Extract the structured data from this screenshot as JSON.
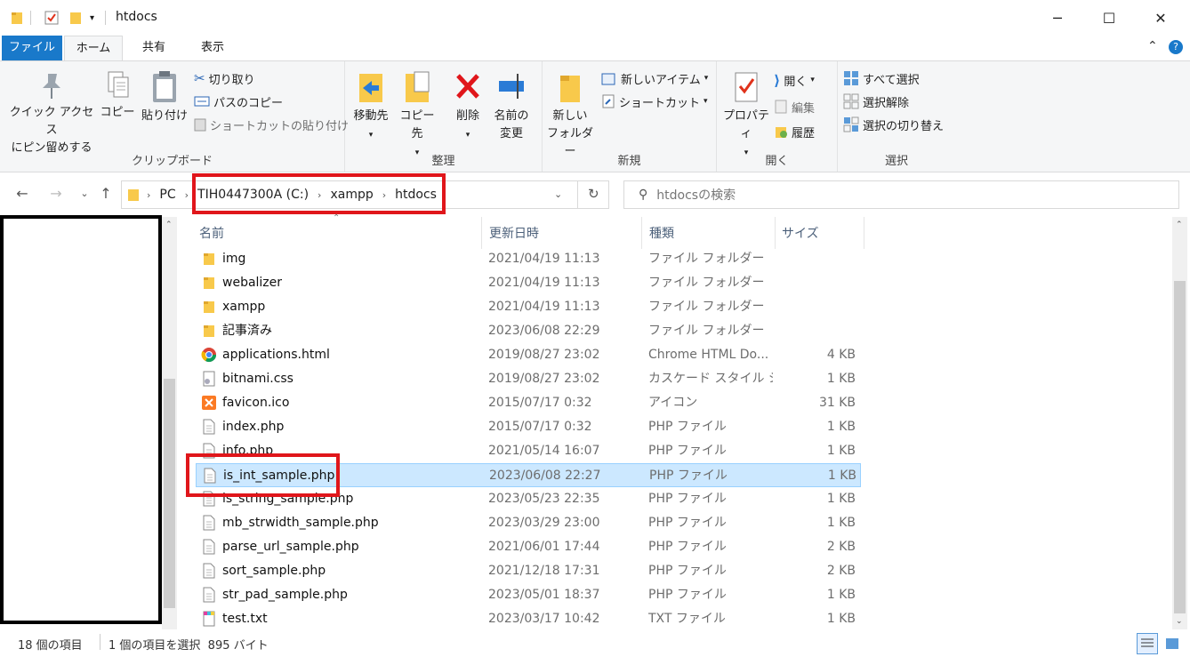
{
  "window": {
    "title": "htdocs",
    "minimize": "─",
    "maximize": "☐",
    "close": "✕"
  },
  "tabs": {
    "file": "ファイル",
    "home": "ホーム",
    "share": "共有",
    "view": "表示"
  },
  "ribbon": {
    "clipboard": {
      "label": "クリップボード",
      "pin_line1": "クイック アクセス",
      "pin_line2": "にピン留めする",
      "copy": "コピー",
      "paste": "貼り付け",
      "cut": "切り取り",
      "copy_path": "パスのコピー",
      "paste_shortcut": "ショートカットの貼り付け"
    },
    "organize": {
      "label": "整理",
      "move_to": "移動先",
      "copy_to": "コピー先",
      "delete": "削除",
      "rename_line1": "名前の",
      "rename_line2": "変更"
    },
    "new": {
      "label": "新規",
      "new_folder_line1": "新しい",
      "new_folder_line2": "フォルダー",
      "new_item": "新しいアイテム",
      "shortcut": "ショートカット"
    },
    "open": {
      "label": "開く",
      "properties": "プロパティ",
      "open": "開く",
      "edit": "編集",
      "history": "履歴"
    },
    "select": {
      "label": "選択",
      "select_all": "すべて選択",
      "select_none": "選択解除",
      "invert": "選択の切り替え"
    }
  },
  "address": {
    "crumbs": [
      "PC",
      "TIH0447300A (C:)",
      "xampp",
      "htdocs"
    ],
    "search_placeholder": "htdocsの検索"
  },
  "columns": {
    "name": "名前",
    "date": "更新日時",
    "type": "種類",
    "size": "サイズ"
  },
  "files": [
    {
      "name": "img",
      "date": "2021/04/19 11:13",
      "type": "ファイル フォルダー",
      "size": "",
      "icon": "folder-icon"
    },
    {
      "name": "webalizer",
      "date": "2021/04/19 11:13",
      "type": "ファイル フォルダー",
      "size": "",
      "icon": "folder-icon"
    },
    {
      "name": "xampp",
      "date": "2021/04/19 11:13",
      "type": "ファイル フォルダー",
      "size": "",
      "icon": "folder-icon"
    },
    {
      "name": "記事済み",
      "date": "2023/06/08 22:29",
      "type": "ファイル フォルダー",
      "size": "",
      "icon": "folder-icon"
    },
    {
      "name": "applications.html",
      "date": "2019/08/27 23:02",
      "type": "Chrome HTML Do...",
      "size": "4 KB",
      "icon": "chrome-icon"
    },
    {
      "name": "bitnami.css",
      "date": "2019/08/27 23:02",
      "type": "カスケード スタイル シ...",
      "size": "1 KB",
      "icon": "css-file-icon"
    },
    {
      "name": "favicon.ico",
      "date": "2015/07/17 0:32",
      "type": "アイコン",
      "size": "31 KB",
      "icon": "xampp-icon"
    },
    {
      "name": "index.php",
      "date": "2015/07/17 0:32",
      "type": "PHP ファイル",
      "size": "1 KB",
      "icon": "file-icon"
    },
    {
      "name": "info.php",
      "date": "2021/05/14 16:07",
      "type": "PHP ファイル",
      "size": "1 KB",
      "icon": "file-icon"
    },
    {
      "name": "is_int_sample.php",
      "date": "2023/06/08 22:27",
      "type": "PHP ファイル",
      "size": "1 KB",
      "icon": "file-icon",
      "selected": true
    },
    {
      "name": "is_string_sample.php",
      "date": "2023/05/23 22:35",
      "type": "PHP ファイル",
      "size": "1 KB",
      "icon": "file-icon"
    },
    {
      "name": "mb_strwidth_sample.php",
      "date": "2023/03/29 23:00",
      "type": "PHP ファイル",
      "size": "1 KB",
      "icon": "file-icon"
    },
    {
      "name": "parse_url_sample.php",
      "date": "2021/06/01 17:44",
      "type": "PHP ファイル",
      "size": "2 KB",
      "icon": "file-icon"
    },
    {
      "name": "sort_sample.php",
      "date": "2021/12/18 17:31",
      "type": "PHP ファイル",
      "size": "2 KB",
      "icon": "file-icon"
    },
    {
      "name": "str_pad_sample.php",
      "date": "2023/05/01 18:37",
      "type": "PHP ファイル",
      "size": "1 KB",
      "icon": "file-icon"
    },
    {
      "name": "test.txt",
      "date": "2023/03/17 10:42",
      "type": "TXT ファイル",
      "size": "1 KB",
      "icon": "txt-icon"
    }
  ],
  "status": {
    "item_count": "18 個の項目",
    "selection": "1 個の項目を選択  895 バイト"
  },
  "colors": {
    "file_tab": "#1979ca",
    "selection_bg": "#cce8ff",
    "highlight_box": "#e0161b",
    "folder": "#f8c94b"
  }
}
